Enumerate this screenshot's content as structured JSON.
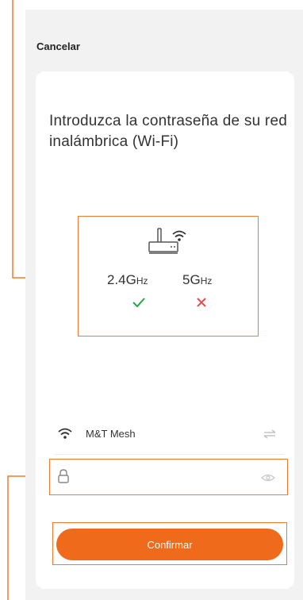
{
  "header": {
    "cancel_label": "Cancelar"
  },
  "intro_text": "Introduzca la contraseña de su red inalámbrica (Wi-Fi)",
  "bands": [
    {
      "main": "2.4G",
      "unit": "Hz",
      "supported": true
    },
    {
      "main": "5G",
      "unit": "Hz",
      "supported": false
    }
  ],
  "wifi": {
    "ssid": "M&T Mesh"
  },
  "password": {
    "value": "",
    "placeholder": ""
  },
  "confirm_label": "Confirmar",
  "colors": {
    "accent": "#f06a1c",
    "annotation": "#f07a2f",
    "ok": "#2aa44a",
    "error": "#e24d4d"
  },
  "icons": [
    "router-icon",
    "wifi-icon",
    "check-icon",
    "cross-icon",
    "switch-network-icon",
    "lock-icon",
    "eye-icon"
  ]
}
